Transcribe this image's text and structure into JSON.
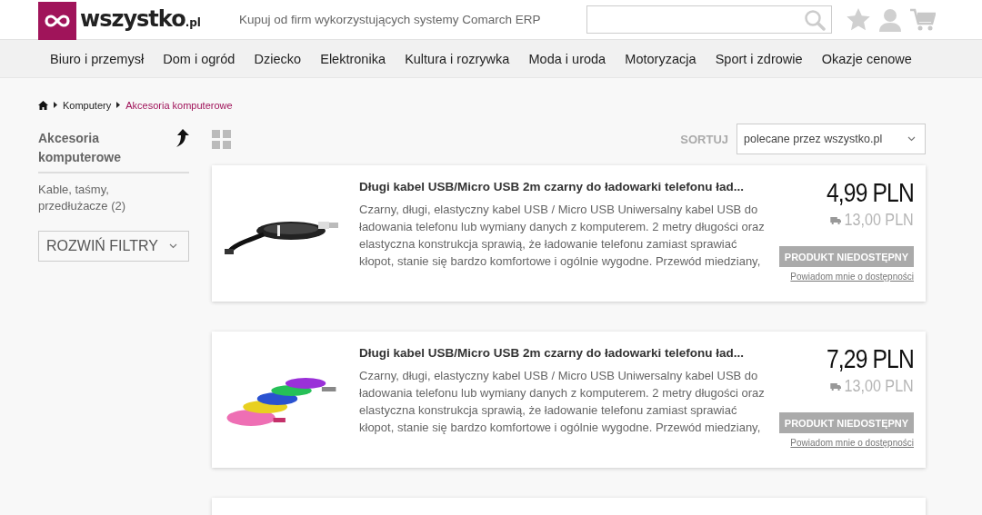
{
  "header": {
    "logo": {
      "name": "wszystko",
      "suffix": ".pl"
    },
    "tagline": "Kupuj od firm wykorzystujących systemy Comarch ERP"
  },
  "nav": [
    "Biuro i przemysł",
    "Dom i ogród",
    "Dziecko",
    "Elektronika",
    "Kultura i rozrywka",
    "Moda i uroda",
    "Motoryzacja",
    "Sport i zdrowie",
    "Okazje cenowe"
  ],
  "breadcrumb": [
    {
      "label": "Komputery",
      "current": false
    },
    {
      "label": "Akcesoria komputerowe",
      "current": true
    }
  ],
  "sidebar": {
    "title": "Akcesoria komputerowe",
    "categories": [
      {
        "label": "Kable, taśmy, przedłużacze (2)"
      }
    ],
    "filter_button": "ROZWIŃ FILTRY"
  },
  "toolbar": {
    "sort_label": "SORTUJ",
    "sort_value": "polecane przez wszystko.pl"
  },
  "products": [
    {
      "title": "Długi kabel USB/Micro USB 2m czarny do ładowarki telefonu ład...",
      "description": "Czarny, długi, elastyczny kabel USB / Micro USB Uniwersalny kabel USB do ładowania telefonu lub wymiany danych z komputerem. 2 metry długości oraz elastyczna konstrukcja sprawią, że ładowanie telefonu zamiast sprawiać kłopot, stanie się bardzo komfortowe i ogólnie wygodne. Przewód miedziany,",
      "price": "4,99 PLN",
      "shipping_price": "13,00 PLN",
      "available": false,
      "button": "PRODUKT NIEDOSTĘPNY",
      "notify_link": "Powiadom mnie o dostępności"
    },
    {
      "title": "Długi kabel USB/Micro USB 2m czarny do ładowarki telefonu ład...",
      "description": "Czarny, długi, elastyczny kabel USB / Micro USB Uniwersalny kabel USB do ładowania telefonu lub wymiany danych z komputerem. 2 metry długości oraz elastyczna konstrukcja sprawią, że ładowanie telefonu zamiast sprawiać kłopot, stanie się bardzo komfortowe i ogólnie wygodne. Przewód miedziany,",
      "price": "7,29 PLN",
      "shipping_price": "13,00 PLN",
      "available": false,
      "button": "PRODUKT NIEDOSTĘPNY",
      "notify_link": "Powiadom mnie o dostępności"
    }
  ]
}
